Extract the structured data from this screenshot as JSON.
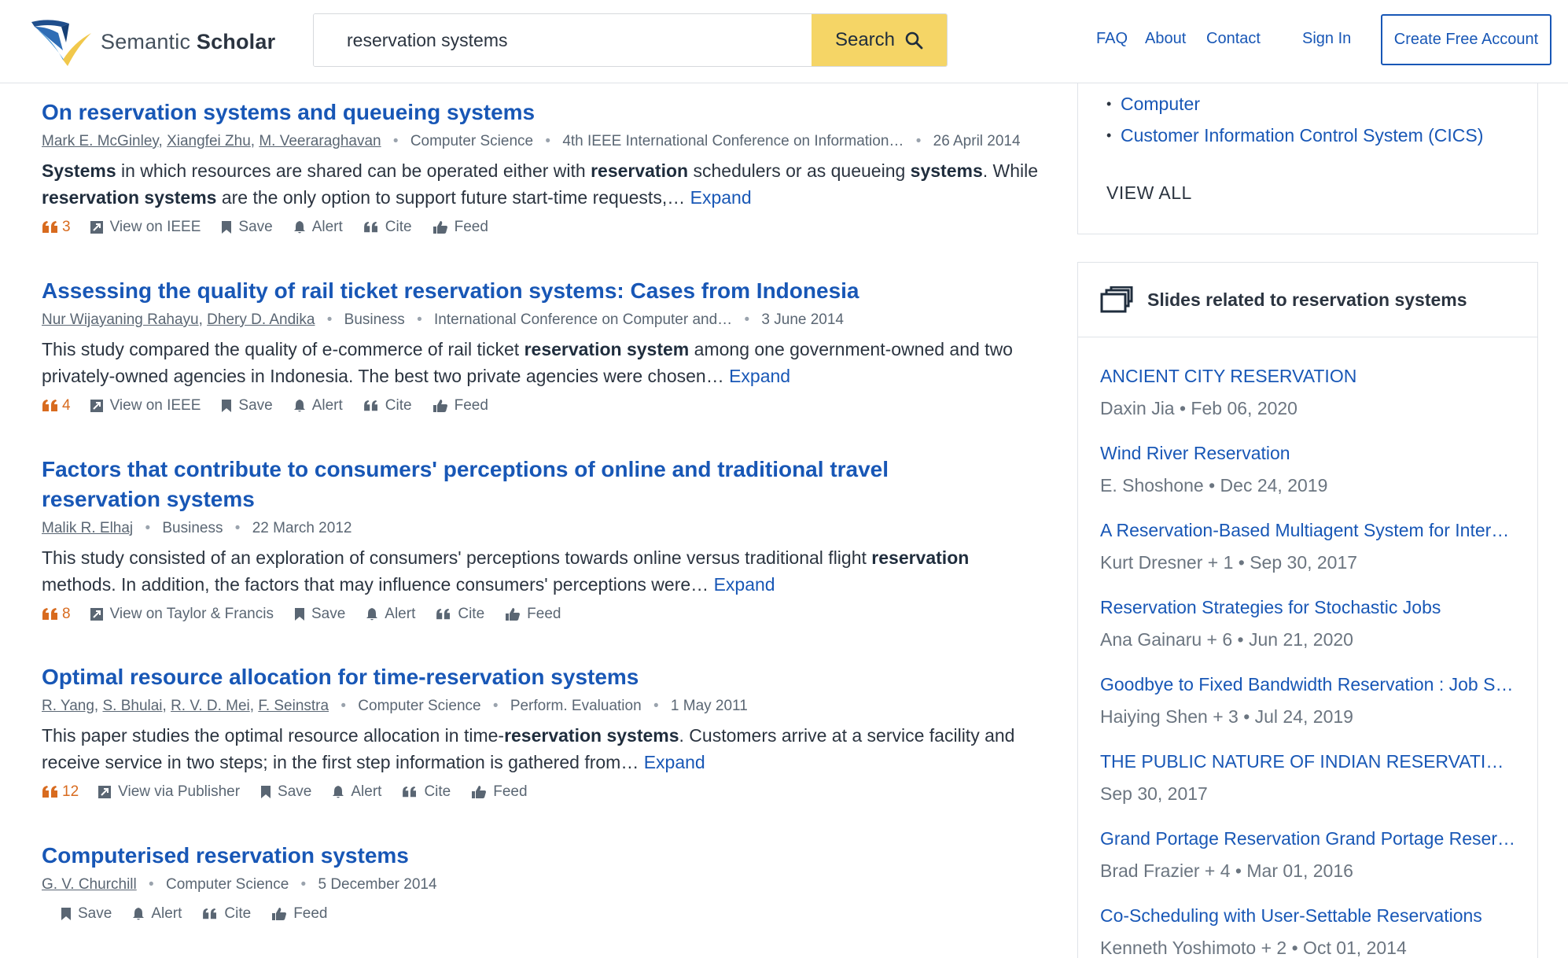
{
  "header": {
    "logo_light": "Semantic ",
    "logo_bold": "Scholar",
    "search_value": "reservation systems",
    "search_label": "Search",
    "nav": [
      "FAQ",
      "About",
      "Contact",
      "Sign In"
    ],
    "create_account": "Create Free Account"
  },
  "results": [
    {
      "title": "On reservation systems and queueing systems",
      "authors": [
        "Mark E. McGinley",
        "Xiangfei Zhu",
        "M. Veeraraghavan"
      ],
      "field": "Computer Science",
      "venue": "4th IEEE International Conference on Information…",
      "date": "26 April 2014",
      "abstract_html": "<b>Systems</b> in which resources are shared can be operated either with <b>reservation</b> schedulers or as queueing <b>systems</b>. While <b>reservation systems</b> are the only option to support future start-time requests,… ",
      "expand": "Expand",
      "citations": "3",
      "view_link": "View on IEEE",
      "save": "Save",
      "alert": "Alert",
      "cite": "Cite",
      "feed": "Feed"
    },
    {
      "title": "Assessing the quality of rail ticket reservation systems: Cases from Indonesia",
      "authors": [
        "Nur Wijayaning Rahayu",
        "Dhery D. Andika"
      ],
      "field": "Business",
      "venue": "International Conference on Computer and…",
      "date": "3 June 2014",
      "abstract_html": "This study compared the quality of e-commerce of rail ticket <b>reservation system</b> among one government-owned and two privately-owned agencies in Indonesia. The best two private agencies were chosen… ",
      "expand": "Expand",
      "citations": "4",
      "view_link": "View on IEEE",
      "save": "Save",
      "alert": "Alert",
      "cite": "Cite",
      "feed": "Feed"
    },
    {
      "title": "Factors that contribute to consumers' perceptions of online and traditional travel reservation systems",
      "authors": [
        "Malik R. Elhaj"
      ],
      "field": "Business",
      "venue": "",
      "date": "22 March 2012",
      "abstract_html": "This study consisted of an exploration of consumers' perceptions towards online versus traditional flight <b>reservation</b> methods. In addition, the factors that may influence consumers' perceptions were… ",
      "expand": "Expand",
      "citations": "8",
      "view_link": "View on Taylor & Francis",
      "save": "Save",
      "alert": "Alert",
      "cite": "Cite",
      "feed": "Feed"
    },
    {
      "title": "Optimal resource allocation for time-reservation systems",
      "authors": [
        "R. Yang",
        "S. Bhulai",
        "R. V. D. Mei",
        "F. Seinstra"
      ],
      "field": "Computer Science",
      "venue": "Perform. Evaluation",
      "date": "1 May 2011",
      "abstract_html": "This paper studies the optimal resource allocation in time-<b>reservation systems</b>. Customers arrive at a service facility and receive service in two steps; in the first step information is gathered from… ",
      "expand": "Expand",
      "citations": "12",
      "view_link": "View via Publisher",
      "save": "Save",
      "alert": "Alert",
      "cite": "Cite",
      "feed": "Feed"
    },
    {
      "title": "Computerised reservation systems",
      "authors": [
        "G. V. Churchill"
      ],
      "field": "Computer Science",
      "venue": "",
      "date": "5 December 2014",
      "abstract_html": "",
      "expand": "",
      "citations": "",
      "view_link": "",
      "save": "Save",
      "alert": "Alert",
      "cite": "Cite",
      "feed": "Feed"
    }
  ],
  "topics": {
    "items": [
      "Computer",
      "Customer Information Control System (CICS)"
    ],
    "view_all": "VIEW ALL"
  },
  "slides": {
    "heading": "Slides related to reservation systems",
    "items": [
      {
        "title": "ANCIENT CITY RESERVATION",
        "meta": "Daxin Jia • Feb 06, 2020"
      },
      {
        "title": "Wind River Reservation",
        "meta": "E. Shoshone • Dec 24, 2019"
      },
      {
        "title": "A Reservation-Based Multiagent System for Intersection Control",
        "meta": "Kurt Dresner + 1 • Sep 30, 2017"
      },
      {
        "title": "Reservation Strategies for Stochastic Jobs",
        "meta": "Ana Gainaru + 6 • Jun 21, 2020"
      },
      {
        "title": "Goodbye to Fixed Bandwidth Reservation : Job Scheduling",
        "meta": "Haiying Shen + 3 • Jul 24, 2019"
      },
      {
        "title": "THE PUBLIC NATURE OF INDIAN RESERVATION LANDS",
        "meta": "Sep 30, 2017"
      },
      {
        "title": "Grand Portage Reservation Grand Portage Reservation",
        "meta": "Brad Frazier + 4 • Mar 01, 2016"
      },
      {
        "title": "Co-Scheduling with User-Settable Reservations",
        "meta": "Kenneth Yoshimoto + 2 • Oct 01, 2014"
      }
    ]
  },
  "colors": {
    "link": "#1857b6",
    "search_button": "#f5d566",
    "citation": "#d86b1f"
  }
}
